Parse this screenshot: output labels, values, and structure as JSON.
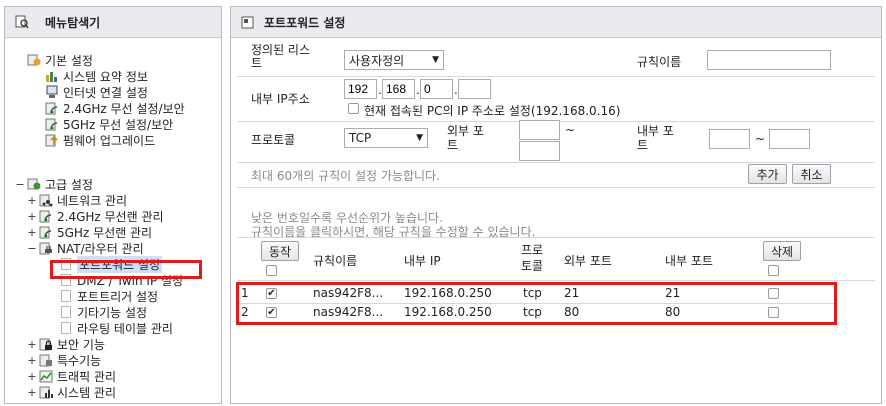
{
  "nav": {
    "title": "메뉴탐색기",
    "basic": {
      "label": "기본 설정",
      "items": [
        "시스템 요약 정보",
        "인터넷 연결 설정",
        "2.4GHz 무선 설정/보안",
        "5GHz 무선 설정/보안",
        "펌웨어 업그레이드"
      ]
    },
    "advanced": {
      "toggle": "−",
      "label": "고급 설정",
      "items": [
        {
          "toggle": "+",
          "label": "네트워크 관리"
        },
        {
          "toggle": "+",
          "label": "2.4GHz 무선랜 관리"
        },
        {
          "toggle": "+",
          "label": "5GHz 무선랜 관리"
        },
        {
          "toggle": "−",
          "label": "NAT/라우터 관리"
        }
      ],
      "nat_items": [
        "포트포워드 설정",
        "DMZ / Twin IP 설정",
        "포트트리거 설정",
        "기타기능 설정",
        "라우팅 테이블 관리"
      ],
      "others": [
        {
          "toggle": "+",
          "label": "보안 기능"
        },
        {
          "toggle": "+",
          "label": "특수기능"
        },
        {
          "toggle": "+",
          "label": "트래픽 관리"
        },
        {
          "toggle": "+",
          "label": "시스템 관리"
        }
      ]
    }
  },
  "main": {
    "title": "포트포워드 설정",
    "form": {
      "predefined_label": "정의된 리스트",
      "predefined_value": "사용자정의",
      "rule_name_label": "규칙이름",
      "rule_name_value": "",
      "internal_ip_label": "내부 IP주소",
      "ip": [
        "192",
        "168",
        "0",
        ""
      ],
      "current_ip_check_label": "현재 접속된 PC의 IP 주소로 설정(192.168.0.16)",
      "protocol_label": "프로토콜",
      "protocol_value": "TCP",
      "external_port_label": "외부 포트",
      "internal_port_label": "내부 포트",
      "tilde": "~",
      "limit_note": "최대 60개의 규칙이 설정 가능합니다.",
      "add_label": "추가",
      "cancel_label": "취소"
    },
    "notes": [
      "낮은 번호일수록 우선순위가 높습니다.",
      "규칙이름을 클릭하시면, 해당 규칙을 수정할 수 있습니다."
    ],
    "table": {
      "action_label": "동작",
      "delete_label": "삭제",
      "columns": [
        "규칙이름",
        "내부 IP",
        "프로토콜",
        "외부 포트",
        "내부 포트"
      ],
      "rows": [
        {
          "num": "1",
          "enabled": true,
          "name": "nas942F8...",
          "ip": "192.168.0.250",
          "proto": "tcp",
          "ext": "21",
          "int": "21"
        },
        {
          "num": "2",
          "enabled": true,
          "name": "nas942F8...",
          "ip": "192.168.0.250",
          "proto": "tcp",
          "ext": "80",
          "int": "80"
        }
      ]
    }
  }
}
